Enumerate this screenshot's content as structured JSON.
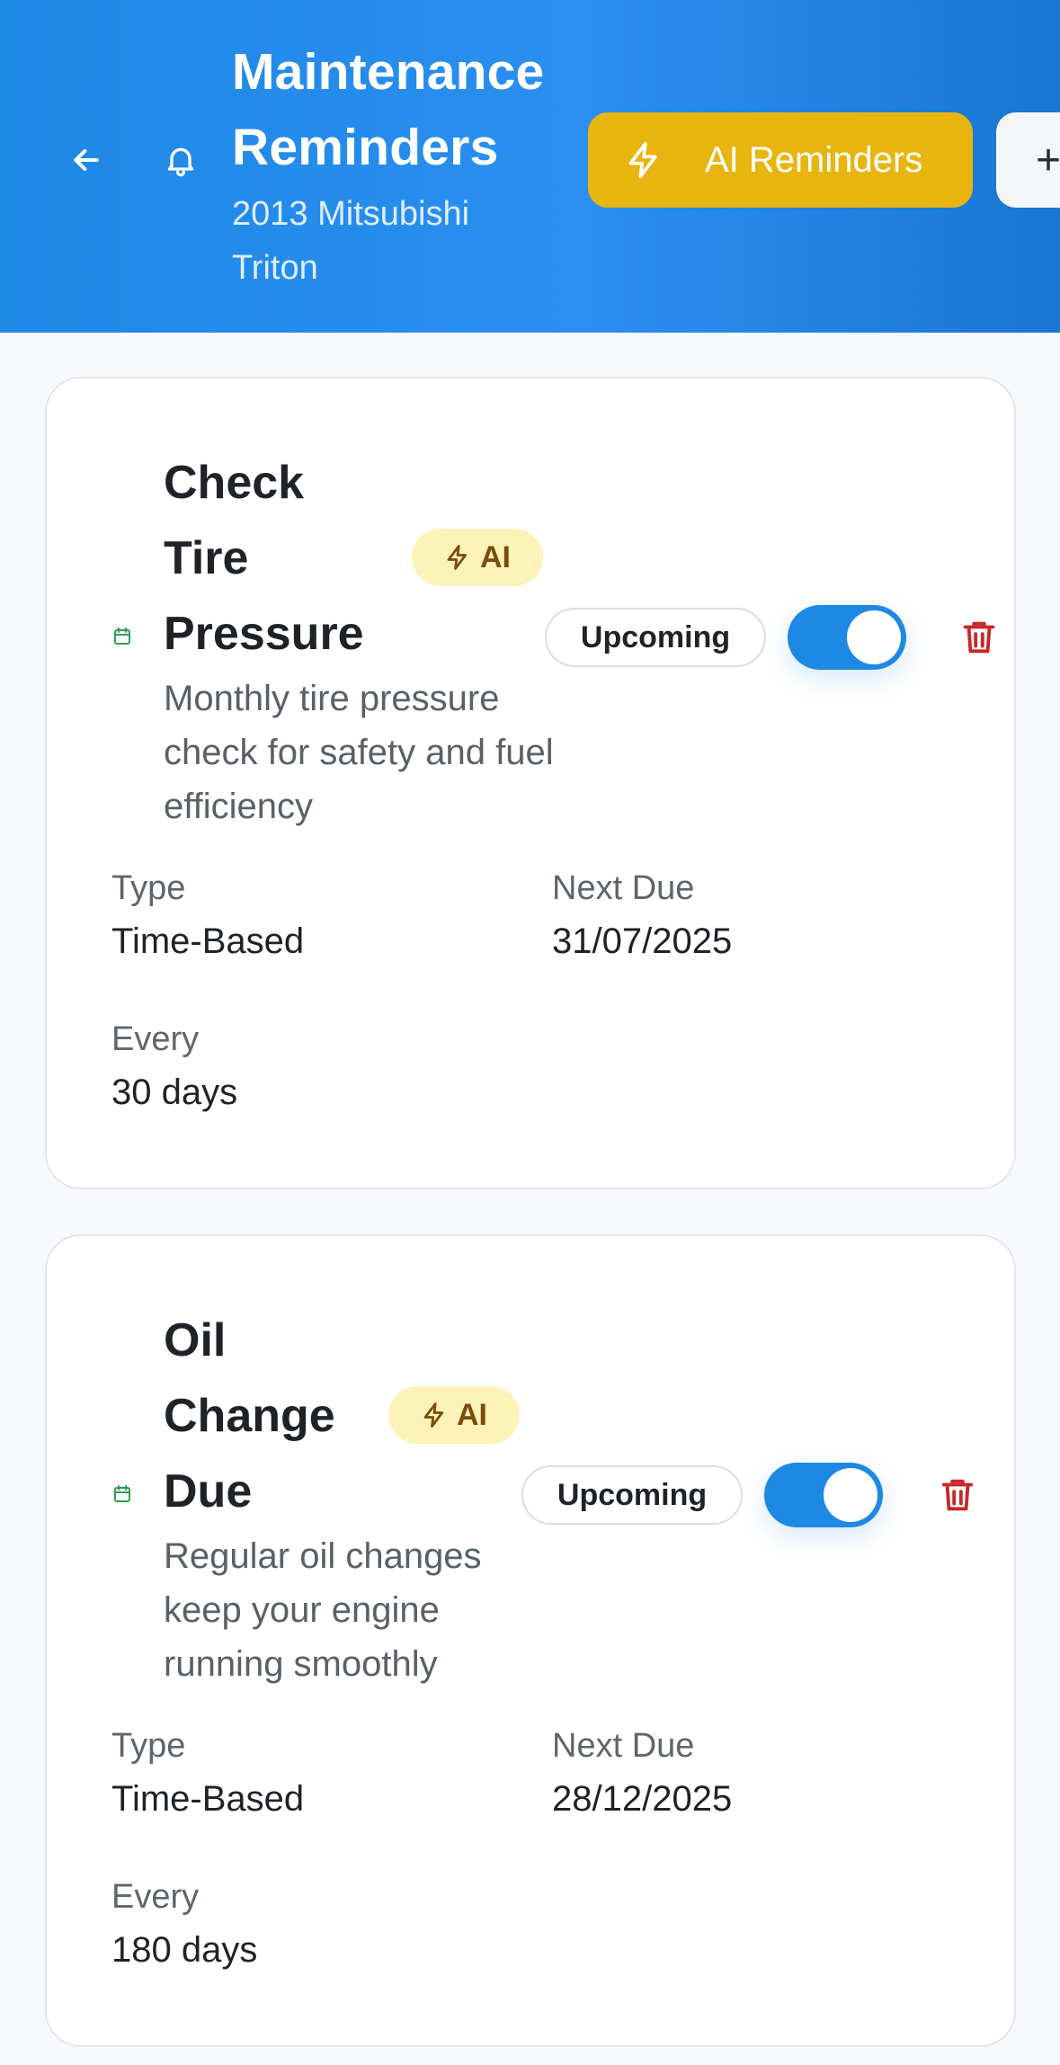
{
  "header": {
    "title": "Maintenance Reminders",
    "title_line1": "Maintenance",
    "title_line2": "Reminders",
    "subtitle_line1": "2013 Mitsubishi",
    "subtitle_line2": "Triton",
    "ai_button_label": "AI Reminders",
    "add_button_glyph": "+",
    "icons": [
      "arrow-left-icon",
      "bell-icon",
      "lightning-icon",
      "plus-icon"
    ]
  },
  "colors": {
    "header_blue": "#1e88e5",
    "ai_button": "#e8b50f",
    "ai_badge_bg": "#fdf3b8",
    "ai_badge_text": "#7a4c0a",
    "toggle_on": "#1e88e5",
    "delete_red": "#c62828",
    "calendar_green": "#2e9e57"
  },
  "labels": {
    "type": "Type",
    "next_due": "Next Due",
    "every": "Every"
  },
  "reminders": [
    {
      "title_lines": [
        "Check",
        "Tire",
        "Pressure"
      ],
      "ai_badge": "AI",
      "description": "Monthly tire pressure check for safety and fuel efficiency",
      "status": "Upcoming",
      "enabled": true,
      "type": "Time-Based",
      "next_due": "31/07/2025",
      "every": "30 days"
    },
    {
      "title_lines": [
        "Oil",
        "Change",
        "Due"
      ],
      "ai_badge": "AI",
      "description": "Regular oil changes keep your engine running smoothly",
      "status": "Upcoming",
      "enabled": true,
      "type": "Time-Based",
      "next_due": "28/12/2025",
      "every": "180 days"
    }
  ]
}
